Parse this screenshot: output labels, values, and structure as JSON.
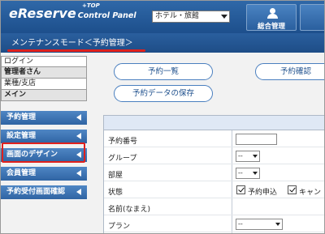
{
  "header": {
    "logo_main": "eReserve",
    "logo_sub": "Control Panel",
    "top_link": "+TOP",
    "facility_select_value": "ホテル・旅館",
    "management_button_label": "総合管理"
  },
  "mode_title": "メンテナンスモード＜予約管理＞",
  "user_info": {
    "login_label": "ログイン",
    "user_name": "管理者さん",
    "branch_label": "業種/支店",
    "main_label": "メイン"
  },
  "nav": {
    "items": [
      {
        "label": "予約管理"
      },
      {
        "label": "設定管理"
      },
      {
        "label": "画面のデザイン"
      },
      {
        "label": "会員管理"
      },
      {
        "label": "予約受付画面確認"
      }
    ]
  },
  "actions": {
    "reservation_list": "予約一覧",
    "reservation_confirm": "予約確認",
    "save_reservation_data": "予約データの保存"
  },
  "form": {
    "reservation_number_label": "予約番号",
    "group_label": "グループ",
    "group_value": "--",
    "room_label": "部屋",
    "room_value": "--",
    "status_label": "状態",
    "status_option1": "予約申込",
    "status_option2": "キャン",
    "name_label": "名前(なまえ)",
    "plan_label": "プラン",
    "plan_value": "--"
  }
}
